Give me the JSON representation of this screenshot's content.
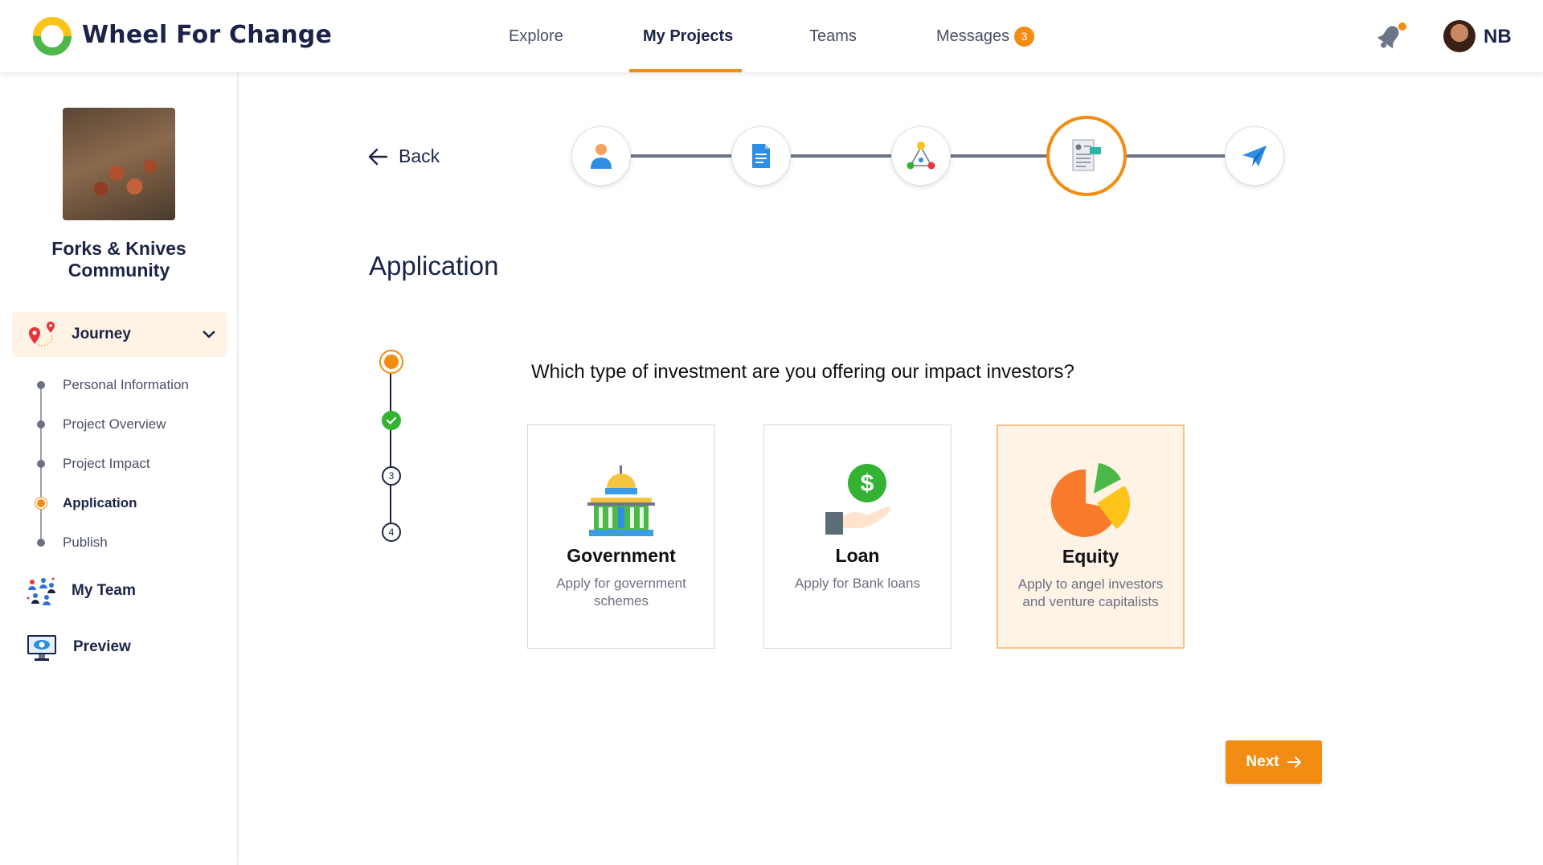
{
  "header": {
    "brand": "Wheel For Change",
    "nav": [
      {
        "label": "Explore"
      },
      {
        "label": "My Projects"
      },
      {
        "label": "Teams"
      },
      {
        "label": "Messages"
      }
    ],
    "messages_badge": "3",
    "user_initials": "NB",
    "accent_color": "#f28c12"
  },
  "sidebar": {
    "project_name": "Forks & Knives Community",
    "journey_label": "Journey",
    "journey_steps": [
      {
        "label": "Personal Information"
      },
      {
        "label": "Project Overview"
      },
      {
        "label": "Project Impact"
      },
      {
        "label": "Application"
      },
      {
        "label": "Publish"
      }
    ],
    "my_team_label": "My Team",
    "preview_label": "Preview"
  },
  "main": {
    "back_label": "Back",
    "stepper_icons": [
      "person-icon",
      "document-icon",
      "network-icon",
      "application-form-icon",
      "send-icon"
    ],
    "page_title": "Application",
    "substeps": [
      "3",
      "4"
    ],
    "question": "Which type of investment are you offering our impact investors?",
    "options": [
      {
        "title": "Government",
        "description": "Apply for government schemes",
        "icon": "government-building-icon",
        "selected": false
      },
      {
        "title": "Loan",
        "description": "Apply for Bank loans",
        "icon": "loan-dollar-hand-icon",
        "selected": false
      },
      {
        "title": "Equity",
        "description": "Apply to angel investors and venture capitalists",
        "icon": "pie-chart-icon",
        "selected": true
      }
    ],
    "next_label": "Next"
  }
}
